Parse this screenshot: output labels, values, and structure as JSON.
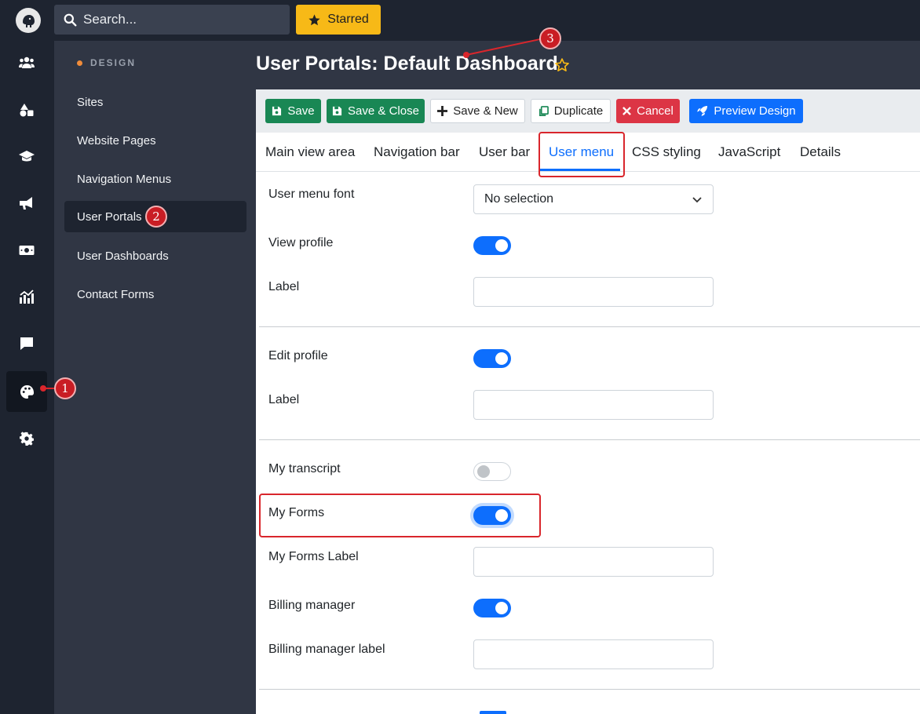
{
  "search": {
    "placeholder": "Search..."
  },
  "starred_label": "Starred",
  "rail_icons": [
    "users-icon",
    "shapes-icon",
    "graduation-cap-icon",
    "megaphone-icon",
    "money-icon",
    "analytics-chart-icon",
    "chat-icon",
    "palette-icon",
    "gear-icon"
  ],
  "sidebar": {
    "heading": "DESIGN",
    "items": [
      {
        "label": "Sites"
      },
      {
        "label": "Website Pages"
      },
      {
        "label": "Navigation Menus"
      },
      {
        "label": "User Portals",
        "active": true
      },
      {
        "label": "User Dashboards"
      },
      {
        "label": "Contact Forms"
      }
    ]
  },
  "page_title": "User Portals: Default Dashboard",
  "toolbar": {
    "save": "Save",
    "save_close": "Save & Close",
    "save_new": "Save & New",
    "duplicate": "Duplicate",
    "cancel": "Cancel",
    "preview": "Preview Design"
  },
  "tabs": [
    "Main view area",
    "Navigation bar",
    "User bar",
    "User menu",
    "CSS styling",
    "JavaScript",
    "Details"
  ],
  "active_tab": "User menu",
  "form": {
    "user_menu_font": {
      "label": "User menu font",
      "value": "No selection"
    },
    "view_profile": {
      "label": "View profile",
      "checked": true
    },
    "view_profile_label": {
      "label": "Label",
      "value": ""
    },
    "edit_profile": {
      "label": "Edit profile",
      "checked": true
    },
    "edit_profile_label": {
      "label": "Label",
      "value": ""
    },
    "my_transcript": {
      "label": "My transcript",
      "checked": false
    },
    "my_forms": {
      "label": "My Forms",
      "checked": true
    },
    "my_forms_label": {
      "label": "My Forms Label",
      "value": ""
    },
    "billing_manager": {
      "label": "Billing manager",
      "checked": true
    },
    "billing_manager_label": {
      "label": "Billing manager label",
      "value": ""
    }
  },
  "annotations": {
    "one": "1",
    "two": "2",
    "three": "3"
  },
  "colors": {
    "accent": "#0d6efd",
    "success": "#198754",
    "danger": "#dc3545",
    "warning": "#f7b917",
    "annotation": "#d9262c"
  }
}
